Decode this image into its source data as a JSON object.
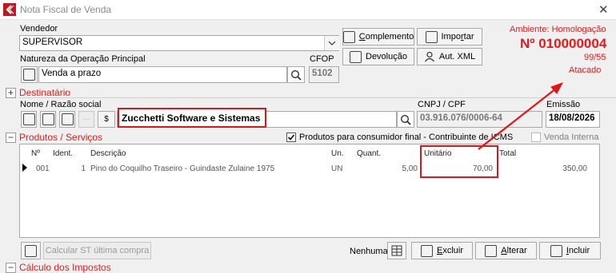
{
  "window": {
    "title": "Nota Fiscal de Venda",
    "close_glyph": "✕"
  },
  "header": {
    "ambiente": "Ambiente: Homologação",
    "numero": "Nº 010000004",
    "serie": "99/55",
    "tipo": "Atacado"
  },
  "vendedor": {
    "label": "Vendedor",
    "value": "SUPERVISOR"
  },
  "natureza": {
    "label": "Natureza da Operação Principal",
    "value": "Venda a prazo"
  },
  "cfop": {
    "label": "CFOP",
    "value": "5102"
  },
  "buttons": {
    "complemento": {
      "prefix": "",
      "key": "C",
      "rest": "omplemento"
    },
    "importar": {
      "prefix": "Impo",
      "key": "r",
      "rest": "tar"
    },
    "devolucao": {
      "prefix": "Devolução",
      "key": "",
      "rest": ""
    },
    "aut_xml": {
      "prefix": "Aut. XML",
      "key": "",
      "rest": ""
    }
  },
  "destinatario": {
    "title": "Destinatário",
    "name_label": "Nome / Razão social",
    "name_value": "Zucchetti Software e Sistemas",
    "cnpj_label": "CNPJ / CPF",
    "cnpj_value": "03.916.076/0006-64",
    "emissao_label": "Emissão",
    "emissao_value": "18/08/2026"
  },
  "produtos": {
    "title": "Produtos / Serviços",
    "consumidor_final": "Produtos para consumidor final  - Contribuinte de ICMS",
    "venda_interna": "Venda Interna",
    "columns": [
      "Nº",
      "Ident.",
      "Descrição",
      "Un.",
      "Quant.",
      "Unitário",
      "Total"
    ],
    "rows": [
      {
        "num": "001",
        "ident": "1",
        "descricao": "Pino do Coquilho Traseiro - Guindaste Zulaine 1975",
        "un": "UN",
        "quant": "5,00",
        "unitario": "70,00",
        "total": "350,00"
      }
    ]
  },
  "footer": {
    "calcular_st": "Calcular ST última compra",
    "nenhuma": "Nenhuma",
    "excluir": {
      "key": "E",
      "rest": "xcluir"
    },
    "alterar": {
      "key": "A",
      "rest": "lterar"
    },
    "incluir": {
      "key": "I",
      "rest": "ncluir"
    }
  },
  "calculo": {
    "title": "Cálculo dos Impostos"
  },
  "colors": {
    "accent_red": "#e41b1b",
    "brand_red": "#c4161c"
  }
}
